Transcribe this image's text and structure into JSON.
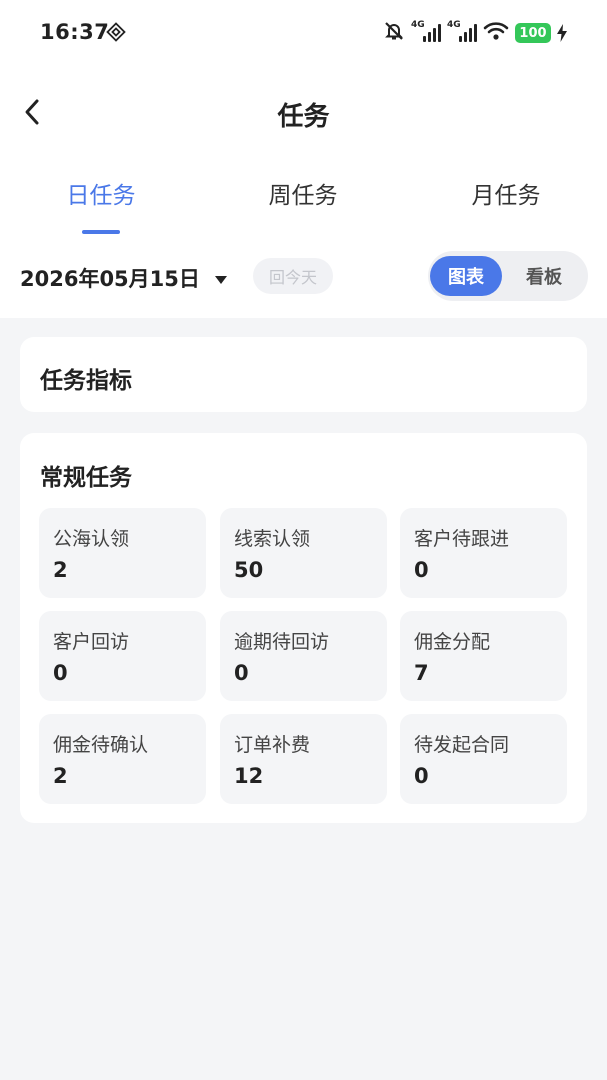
{
  "status_bar": {
    "time": "16:37",
    "network_1": "4G",
    "network_2": "4G",
    "battery": "100",
    "battery_color": "#34c759"
  },
  "nav": {
    "title": "任务",
    "back_icon": "chevron-left-icon"
  },
  "tabs": [
    {
      "label": "日任务",
      "active": true
    },
    {
      "label": "周任务",
      "active": false
    },
    {
      "label": "月任务",
      "active": false
    }
  ],
  "date_row": {
    "date": "2026年05月15日",
    "today_label": "回今天",
    "view_options": [
      {
        "label": "图表",
        "selected": true
      },
      {
        "label": "看板",
        "selected": false
      }
    ]
  },
  "indicators_card": {
    "title": "任务指标"
  },
  "regular_tasks": {
    "title": "常规任务",
    "items": [
      {
        "label": "公海认领",
        "value": "2"
      },
      {
        "label": "线索认领",
        "value": "50"
      },
      {
        "label": "客户待跟进",
        "value": "0"
      },
      {
        "label": "客户回访",
        "value": "0"
      },
      {
        "label": "逾期待回访",
        "value": "0"
      },
      {
        "label": "佣金分配",
        "value": "7"
      },
      {
        "label": "佣金待确认",
        "value": "2"
      },
      {
        "label": "订单补费",
        "value": "12"
      },
      {
        "label": "待发起合同",
        "value": "0"
      }
    ]
  },
  "colors": {
    "accent": "#4a78e8",
    "page_bg": "#f4f5f7"
  }
}
